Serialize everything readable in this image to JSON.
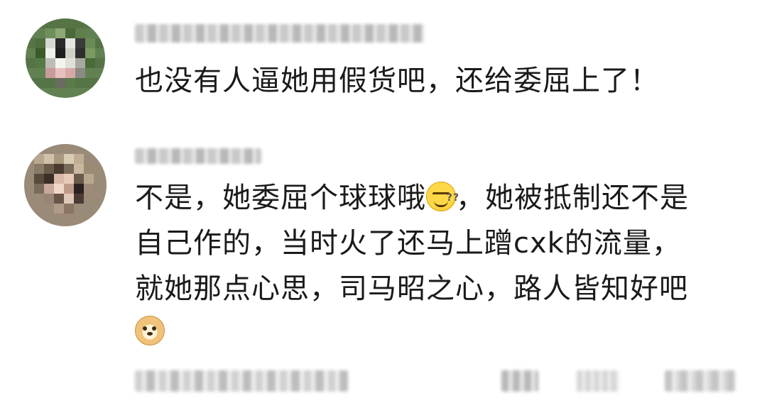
{
  "comments": [
    {
      "username": "",
      "text": "也没有人逼她用假货吧，还给委屈上了！"
    },
    {
      "username": "",
      "lines": [
        "不是，她委屈个球球哦",
        "，她被抵制还不是",
        "自己作的，当时火了还马上蹭cxk的流量，",
        "就她那点心思，司马昭之心，路人皆知好吧"
      ],
      "emoji_inline": "sweat-question-emoji",
      "emoji_end": "doge-emoji"
    }
  ],
  "colors": {
    "text": "#1a1a1a",
    "background": "#ffffff",
    "emoji_yellow": "#ffd84a"
  }
}
